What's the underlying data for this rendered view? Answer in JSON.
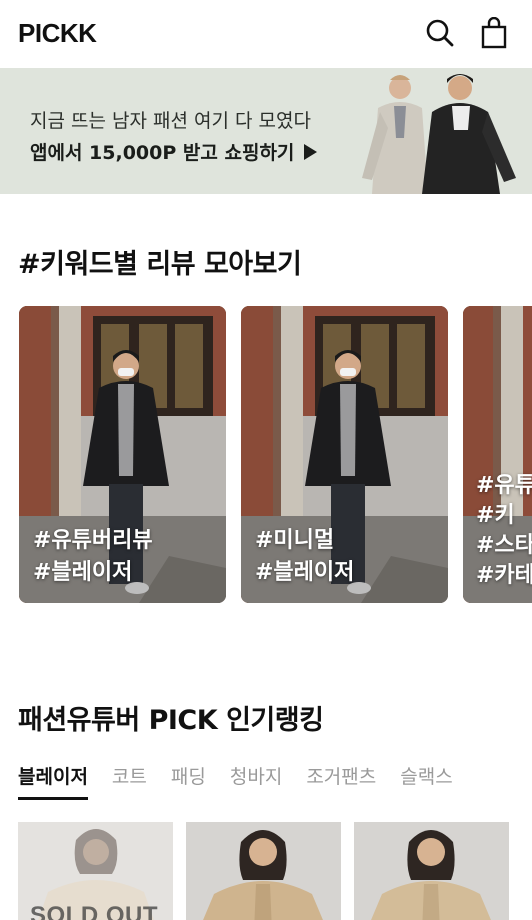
{
  "header": {
    "logo": "PICKK",
    "search_icon": "search-icon",
    "bag_icon": "shopping-bag-icon"
  },
  "banner": {
    "line1": "지금 뜨는 남자 패션 여기 다 모였다",
    "line2": "앱에서 15,000P 받고 쇼핑하기",
    "arrow_icon": "play-arrow-icon",
    "bg_color": "#dfe4dc"
  },
  "reviews": {
    "title": "#키워드별 리뷰 모아보기",
    "cards": [
      {
        "tags": [
          "#유튜버리뷰",
          "#블레이저"
        ]
      },
      {
        "tags": [
          "#미니멀",
          "#블레이저"
        ]
      },
      {
        "tags": [
          "#유튜",
          "#키",
          "#스타",
          "#카테"
        ]
      }
    ]
  },
  "ranking": {
    "title": "패션유튜버 PICK 인기랭킹",
    "tabs": [
      "블레이저",
      "코트",
      "패딩",
      "청바지",
      "조거팬츠",
      "슬랙스"
    ],
    "active_tab": "블레이저",
    "products": [
      {
        "badge": "SOLD OUT"
      },
      {
        "badge": ""
      },
      {
        "badge": ""
      }
    ]
  }
}
